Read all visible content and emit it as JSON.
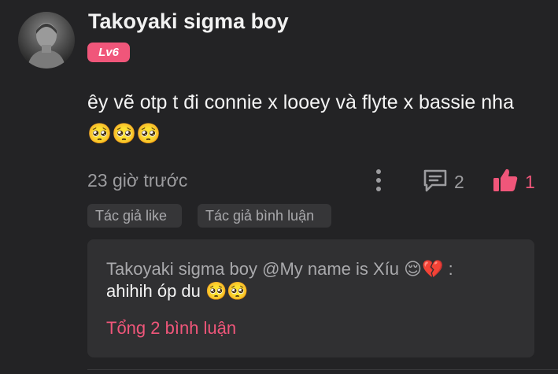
{
  "comment": {
    "username": "Takoyaki sigma boy",
    "level": "Lv6",
    "text": "êy vẽ otp t đi connie x looey và flyte x bassie nha🥺🥺🥺",
    "time": "23 giờ trước",
    "reply_count": "2",
    "like_count": "1",
    "tags": [
      "Tác giả like",
      "Tác giả bình luận"
    ]
  },
  "replies": {
    "preview_author": "Takoyaki sigma boy",
    "preview_mention": "@My name is Xíu",
    "preview_emojis": "😌💔",
    "preview_sep": " :",
    "preview_text": "ahihih óp du 🥺🥺",
    "total_label": "Tổng 2 bình luận"
  },
  "colors": {
    "accent": "#f0567a",
    "background": "#232325",
    "muted_text": "#9c9c9f",
    "reply_box": "#303032"
  },
  "icons": {
    "more": "more-vertical-icon",
    "reply": "comment-icon",
    "like": "thumbs-up-icon"
  }
}
